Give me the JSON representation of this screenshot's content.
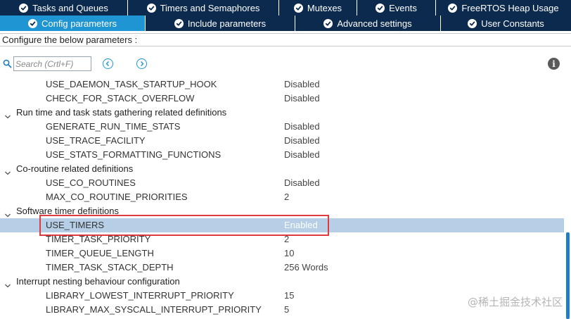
{
  "tabs_row1": [
    {
      "label": "Tasks and Queues"
    },
    {
      "label": "Timers and Semaphores"
    },
    {
      "label": "Mutexes"
    },
    {
      "label": "Events"
    },
    {
      "label": "FreeRTOS Heap Usage"
    }
  ],
  "tabs_row2": [
    {
      "label": "Config parameters",
      "active": true
    },
    {
      "label": "Include parameters"
    },
    {
      "label": "Advanced settings"
    },
    {
      "label": "User Constants"
    }
  ],
  "subtitle": "Configure the below parameters :",
  "search": {
    "placeholder": "Search (Crtl+F)"
  },
  "params": [
    {
      "type": "item",
      "name": "USE_DAEMON_TASK_STARTUP_HOOK",
      "value": "Disabled"
    },
    {
      "type": "item",
      "name": "CHECK_FOR_STACK_OVERFLOW",
      "value": "Disabled"
    },
    {
      "type": "group",
      "label": "Run time and task stats gathering related definitions"
    },
    {
      "type": "item",
      "name": "GENERATE_RUN_TIME_STATS",
      "value": "Disabled"
    },
    {
      "type": "item",
      "name": "USE_TRACE_FACILITY",
      "value": "Disabled"
    },
    {
      "type": "item",
      "name": "USE_STATS_FORMATTING_FUNCTIONS",
      "value": "Disabled"
    },
    {
      "type": "group",
      "label": "Co-routine related definitions"
    },
    {
      "type": "item",
      "name": "USE_CO_ROUTINES",
      "value": "Disabled"
    },
    {
      "type": "item",
      "name": "MAX_CO_ROUTINE_PRIORITIES",
      "value": "2"
    },
    {
      "type": "group",
      "label": "Software timer definitions"
    },
    {
      "type": "item",
      "name": "USE_TIMERS",
      "value": "Enabled",
      "selected": true
    },
    {
      "type": "item",
      "name": "TIMER_TASK_PRIORITY",
      "value": "2"
    },
    {
      "type": "item",
      "name": "TIMER_QUEUE_LENGTH",
      "value": "10"
    },
    {
      "type": "item",
      "name": "TIMER_TASK_STACK_DEPTH",
      "value": "256 Words"
    },
    {
      "type": "group",
      "label": "Interrupt nesting behaviour configuration"
    },
    {
      "type": "item",
      "name": "LIBRARY_LOWEST_INTERRUPT_PRIORITY",
      "value": "15"
    },
    {
      "type": "item",
      "name": "LIBRARY_MAX_SYSCALL_INTERRUPT_PRIORITY",
      "value": "5"
    }
  ],
  "watermark": "@稀土掘金技术社区",
  "colors": {
    "tab_dark": "#0b2a4d",
    "tab_active": "#1f95d3",
    "selection": "#b7cfe6",
    "highlight": "#e0393f"
  }
}
